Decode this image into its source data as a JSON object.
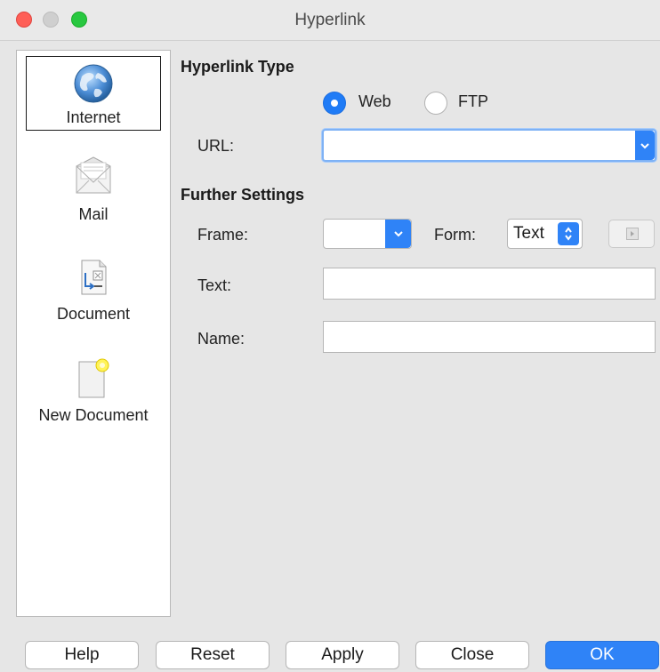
{
  "window": {
    "title": "Hyperlink"
  },
  "sidebar": {
    "items": [
      {
        "label": "Internet",
        "icon": "globe-icon"
      },
      {
        "label": "Mail",
        "icon": "mail-envelope-icon"
      },
      {
        "label": "Document",
        "icon": "document-icon"
      },
      {
        "label": "New Document",
        "icon": "new-document-icon"
      }
    ],
    "selected": "Internet"
  },
  "hyperlink_type": {
    "heading": "Hyperlink Type",
    "options": [
      {
        "label": "Web",
        "checked": true
      },
      {
        "label": "FTP",
        "checked": false
      }
    ],
    "url_label": "URL:",
    "url_value": ""
  },
  "further_settings": {
    "heading": "Further Settings",
    "frame_label": "Frame:",
    "frame_value": "",
    "form_label": "Form:",
    "form_value": "Text",
    "text_label": "Text:",
    "text_value": "",
    "name_label": "Name:",
    "name_value": ""
  },
  "buttons": {
    "help": "Help",
    "reset": "Reset",
    "apply": "Apply",
    "close": "Close",
    "ok": "OK"
  },
  "colors": {
    "accent": "#2f83f7",
    "close_light": "#fe5f57",
    "zoom_light": "#28c840"
  }
}
